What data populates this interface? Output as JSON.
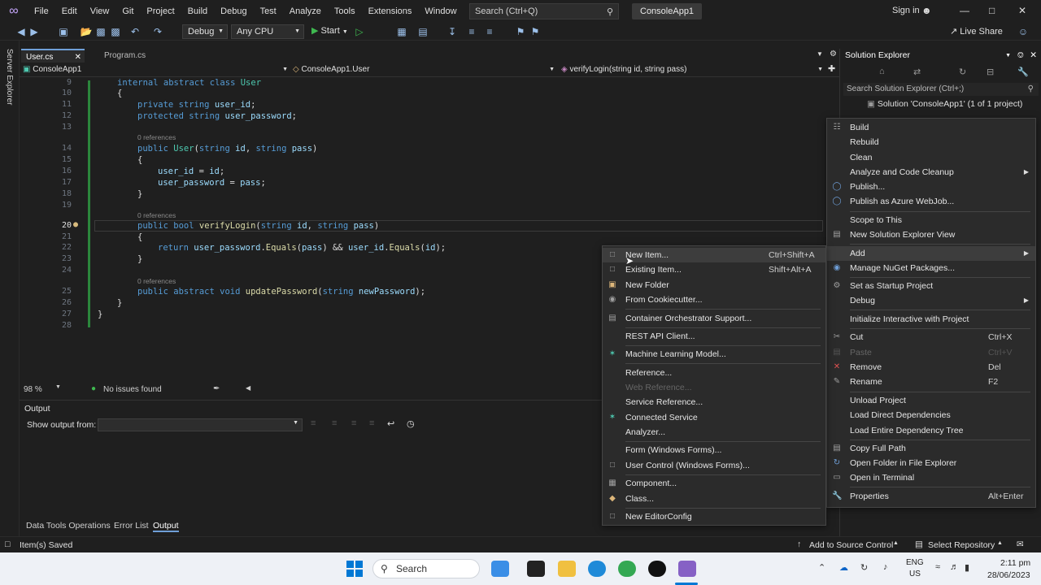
{
  "titlebar": {
    "menu": [
      "File",
      "Edit",
      "View",
      "Git",
      "Project",
      "Build",
      "Debug",
      "Test",
      "Analyze",
      "Tools",
      "Extensions",
      "Window",
      "Help"
    ],
    "search_placeholder": "Search (Ctrl+Q)",
    "solution_name": "ConsoleApp1",
    "sign_in": "Sign in"
  },
  "toolbar": {
    "config": "Debug",
    "platform": "Any CPU",
    "start": "Start",
    "live_share": "Live Share"
  },
  "left_strip": {
    "label": "Server Explorer"
  },
  "tabs": [
    {
      "label": "User.cs"
    },
    {
      "label": "Program.cs"
    }
  ],
  "navbar": {
    "project": "ConsoleApp1",
    "class": "ConsoleApp1.User",
    "member": "verifyLogin(string id, string pass)"
  },
  "editor": {
    "lens_text": "0 references",
    "lines": [
      "9",
      "10",
      "11",
      "12",
      "13",
      "14",
      "15",
      "16",
      "17",
      "18",
      "19",
      "20",
      "21",
      "22",
      "23",
      "24",
      "25",
      "26",
      "27",
      "28"
    ],
    "zoom": "98 %",
    "issues": "No issues found"
  },
  "output": {
    "title": "Output",
    "show_from": "Show output from:"
  },
  "bottom_tabs": [
    "Data Tools Operations",
    "Error List",
    "Output"
  ],
  "solution_explorer": {
    "title": "Solution Explorer",
    "search_placeholder": "Search Solution Explorer (Ctrl+;)",
    "root": "Solution 'ConsoleApp1' (1 of 1 project)"
  },
  "project_menu": {
    "build": "Build",
    "rebuild": "Rebuild",
    "clean": "Clean",
    "analyze": "Analyze and Code Cleanup",
    "publish": "Publish...",
    "publish_azure": "Publish as Azure WebJob...",
    "scope": "Scope to This",
    "new_view": "New Solution Explorer View",
    "add": "Add",
    "nuget": "Manage NuGet Packages...",
    "startup": "Set as Startup Project",
    "debug": "Debug",
    "interactive": "Initialize Interactive with Project",
    "cut": "Cut",
    "cut_sc": "Ctrl+X",
    "paste": "Paste",
    "paste_sc": "Ctrl+V",
    "remove": "Remove",
    "remove_sc": "Del",
    "rename": "Rename",
    "rename_sc": "F2",
    "unload": "Unload Project",
    "load_direct": "Load Direct Dependencies",
    "load_tree": "Load Entire Dependency Tree",
    "copy_path": "Copy Full Path",
    "open_folder": "Open Folder in File Explorer",
    "open_terminal": "Open in Terminal",
    "properties": "Properties",
    "properties_sc": "Alt+Enter"
  },
  "add_menu": {
    "new_item": "New Item...",
    "new_item_sc": "Ctrl+Shift+A",
    "existing_item": "Existing Item...",
    "existing_item_sc": "Shift+Alt+A",
    "new_folder": "New Folder",
    "cookiecutter": "From Cookiecutter...",
    "container": "Container Orchestrator Support...",
    "rest": "REST API Client...",
    "ml": "Machine Learning Model...",
    "reference": "Reference...",
    "web_reference": "Web Reference...",
    "service_reference": "Service Reference...",
    "connected": "Connected Service",
    "analyzer": "Analyzer...",
    "form": "Form (Windows Forms)...",
    "user_control": "User Control (Windows Forms)...",
    "component": "Component...",
    "class": "Class...",
    "editorconfig": "New EditorConfig"
  },
  "statusbar": {
    "left": "Item(s) Saved",
    "source_control": "Add to Source Control",
    "repo": "Select Repository"
  },
  "taskbar": {
    "search": "Search",
    "lang": "ENG",
    "region": "US",
    "time": "2:11 pm",
    "date": "28/06/2023"
  }
}
